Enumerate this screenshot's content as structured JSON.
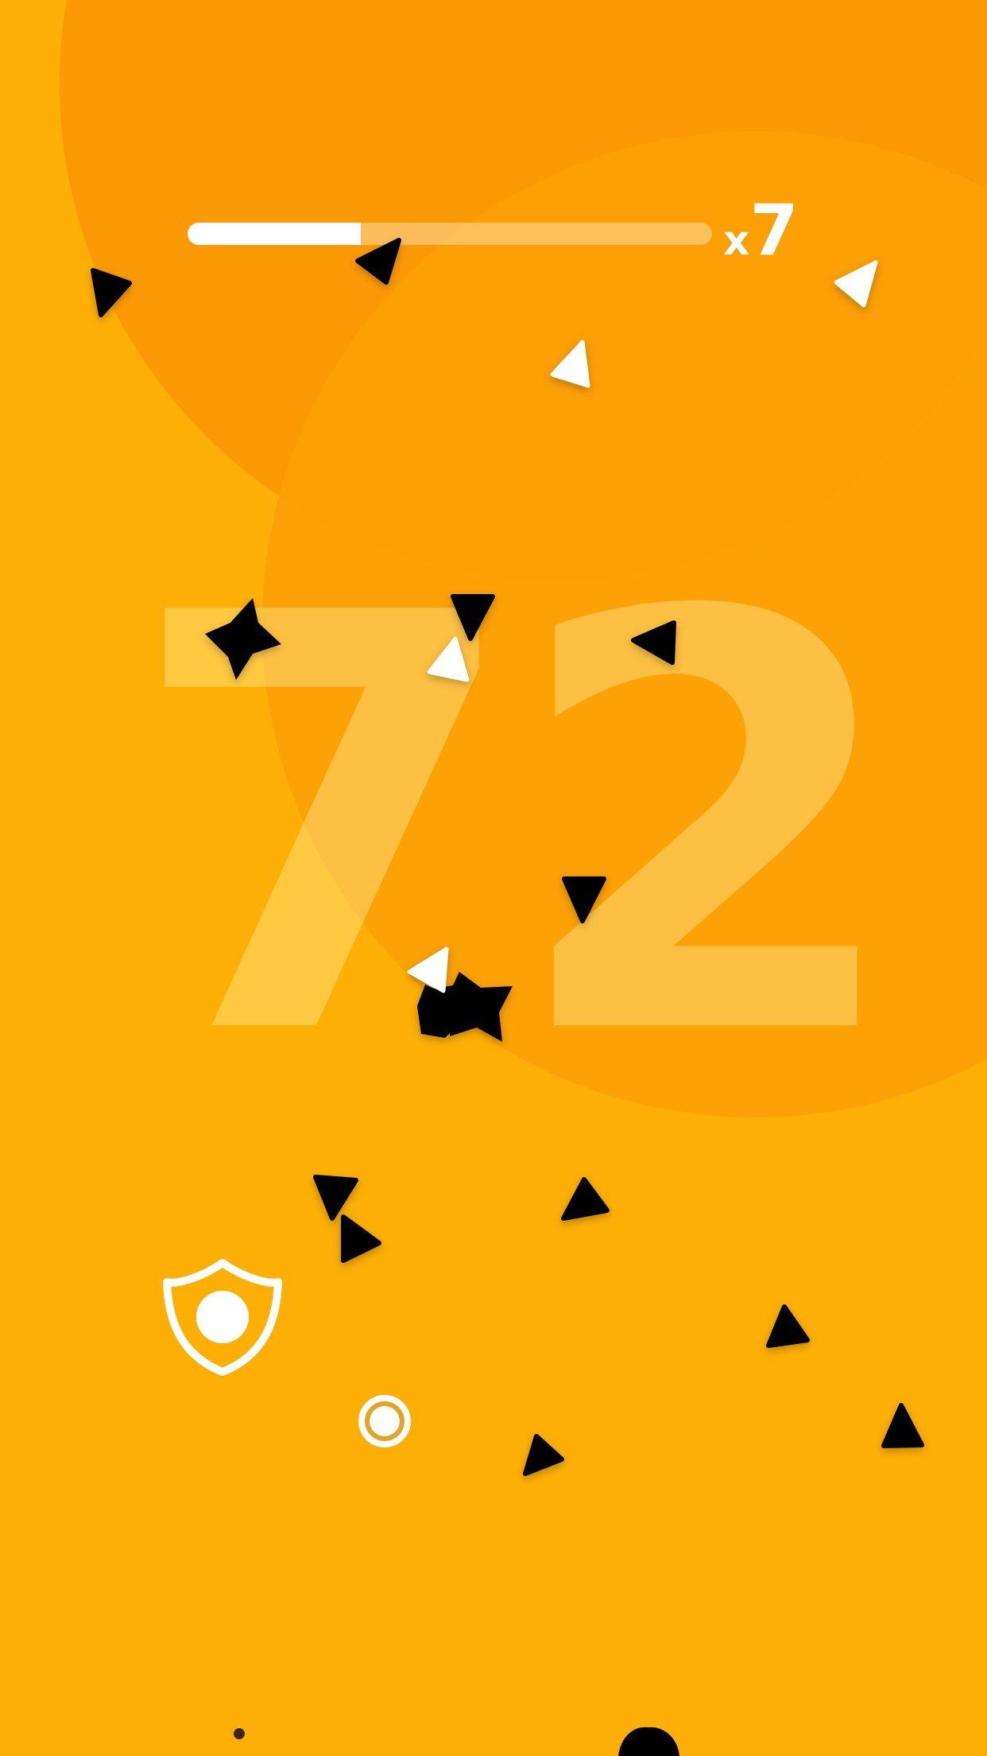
{
  "colors": {
    "background": "#FDAF05",
    "circle_a": "#FC9A06",
    "circle_b": "#FCA006",
    "enemy": "#000000",
    "player": "#FFFFFF",
    "score_text": "#FFE68C"
  },
  "hud": {
    "combo_progress": 0.33,
    "multiplier_prefix": "x",
    "multiplier_value": "7"
  },
  "score": "72",
  "icons": {
    "shield": "shield-powerup-icon",
    "target": "target-ring-icon",
    "enemy_triangle": "black-triangle-icon",
    "enemy_star": "black-star-icon",
    "shard": "white-triangle-icon"
  }
}
